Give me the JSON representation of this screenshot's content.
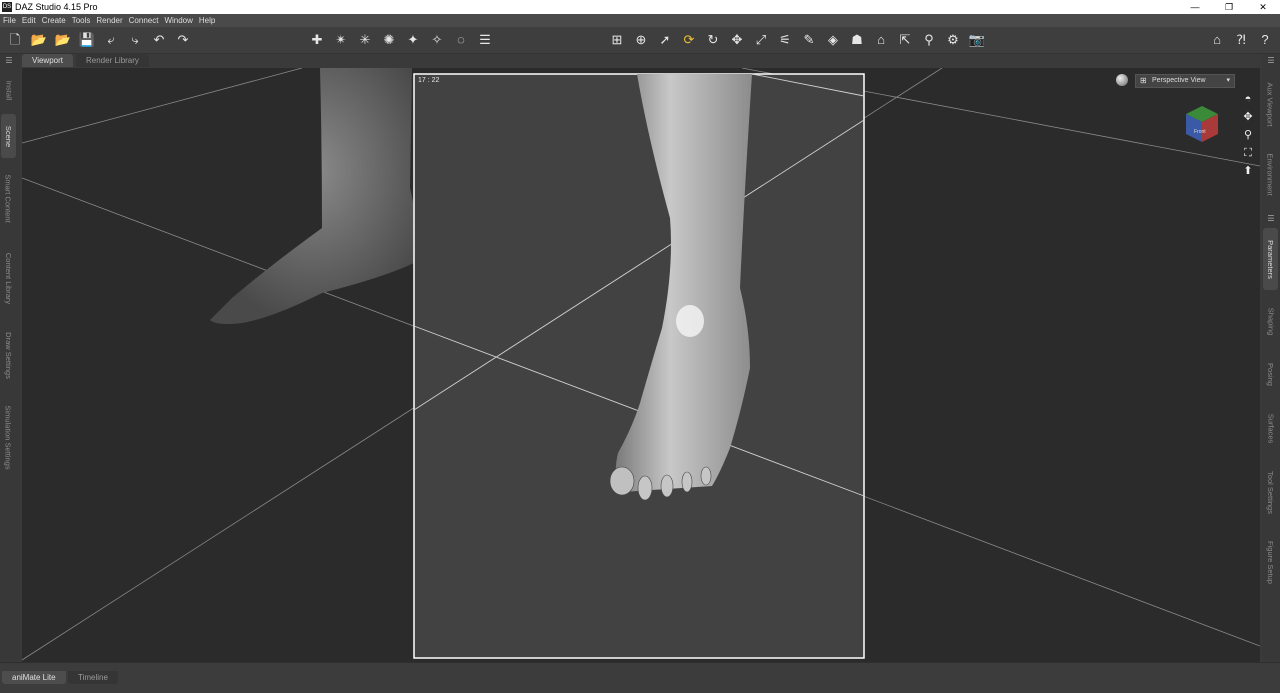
{
  "window": {
    "title": "DAZ Studio 4.15 Pro",
    "icon": "DS",
    "minimize": "—",
    "restore": "❐",
    "close": "✕"
  },
  "menu": [
    "File",
    "Edit",
    "Create",
    "Tools",
    "Render",
    "Connect",
    "Window",
    "Help"
  ],
  "toolbar": {
    "left": [
      {
        "name": "new-scene-icon",
        "glyph": "🗋"
      },
      {
        "name": "open-icon",
        "glyph": "📂"
      },
      {
        "name": "merge-icon",
        "glyph": "📂"
      },
      {
        "name": "save-icon",
        "glyph": "💾"
      },
      {
        "name": "import-icon",
        "glyph": "⤶"
      },
      {
        "name": "export-icon",
        "glyph": "⤷"
      },
      {
        "name": "undo-icon",
        "glyph": "↶"
      },
      {
        "name": "redo-icon",
        "glyph": "↷"
      }
    ],
    "create": [
      {
        "name": "create-camera-icon",
        "glyph": "✚"
      },
      {
        "name": "create-spotlight-icon",
        "glyph": "✴"
      },
      {
        "name": "create-pointlight-icon",
        "glyph": "✳"
      },
      {
        "name": "create-distant-light-icon",
        "glyph": "✺"
      },
      {
        "name": "create-light-icon",
        "glyph": "✦"
      },
      {
        "name": "create-null-icon",
        "glyph": "✧"
      },
      {
        "name": "create-primitive-icon",
        "glyph": "◌"
      },
      {
        "name": "align-icon",
        "glyph": "☰"
      }
    ],
    "tools": [
      {
        "name": "node-selection-icon",
        "glyph": "⊞"
      },
      {
        "name": "universal-tool-icon",
        "glyph": "⊕"
      },
      {
        "name": "select-tool-icon",
        "glyph": "➚"
      },
      {
        "name": "active-pose-icon",
        "glyph": "⟳",
        "selected": true
      },
      {
        "name": "rotate-tool-icon",
        "glyph": "↻"
      },
      {
        "name": "translate-tool-icon",
        "glyph": "✥"
      },
      {
        "name": "scale-tool-icon",
        "glyph": "⤢"
      },
      {
        "name": "joint-editor-icon",
        "glyph": "⚟"
      },
      {
        "name": "weight-map-icon",
        "glyph": "✎"
      },
      {
        "name": "surface-selection-icon",
        "glyph": "◈"
      },
      {
        "name": "figure-geometry-icon",
        "glyph": "☗"
      },
      {
        "name": "node-camera-icon",
        "glyph": "⌂"
      },
      {
        "name": "region-navigator-icon",
        "glyph": "⇱"
      },
      {
        "name": "transfer-utility-icon",
        "glyph": "⚲"
      },
      {
        "name": "render-settings-icon",
        "glyph": "⚙"
      },
      {
        "name": "render-icon",
        "glyph": "📷"
      }
    ],
    "right": [
      {
        "name": "daz-home-icon",
        "glyph": "⌂"
      },
      {
        "name": "whats-this-icon",
        "glyph": "⁈"
      },
      {
        "name": "help-icon",
        "glyph": "?"
      }
    ]
  },
  "tabs": {
    "viewport": "Viewport",
    "render_library": "Render Library"
  },
  "left_panels": [
    "Install",
    "Scene",
    "Smart Content",
    "Content Library",
    "Draw Settings",
    "Simulation Settings"
  ],
  "right_panels": [
    "Aux Viewport",
    "Environment",
    "Parameters",
    "Shaping",
    "Posing",
    "Surfaces",
    "Tool Settings",
    "Figure Setup"
  ],
  "viewport": {
    "frame_ratio": "17 : 22",
    "view": "Perspective View",
    "dropdown": "▾",
    "cube_face": "Front"
  },
  "nav_tools": [
    {
      "name": "orbit-icon",
      "glyph": "◓"
    },
    {
      "name": "pan-icon",
      "glyph": "✥"
    },
    {
      "name": "zoom-icon",
      "glyph": "⚲"
    },
    {
      "name": "frame-icon",
      "glyph": "⛶"
    },
    {
      "name": "reset-view-icon",
      "glyph": "⬆"
    }
  ],
  "bottom_tabs": {
    "animate": "aniMate Lite",
    "timeline": "Timeline"
  },
  "colors": {
    "viewport_bg": "#2b2b2b",
    "frame_bg": "#424242",
    "frame_border": "#ffffff",
    "accent": "#f0c030"
  }
}
